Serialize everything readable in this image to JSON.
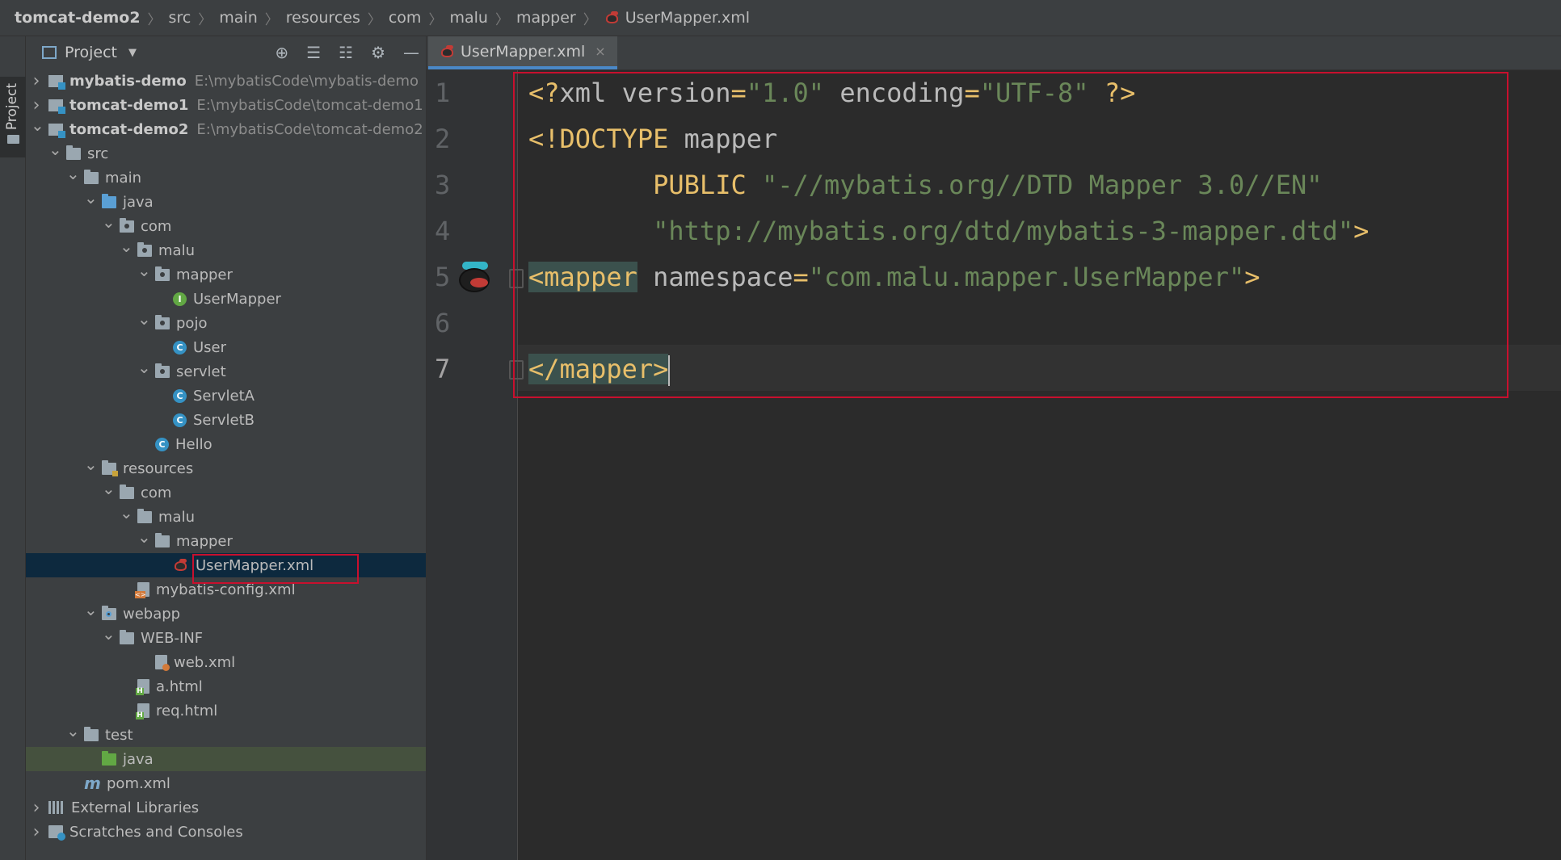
{
  "breadcrumb": [
    "tomcat-demo2",
    "src",
    "main",
    "resources",
    "com",
    "malu",
    "mapper",
    "UserMapper.xml"
  ],
  "stripe": {
    "label": "Project"
  },
  "panel": {
    "title": "Project"
  },
  "tree": [
    {
      "label": "mybatis-demo",
      "path": "E:\\mybatisCode\\mybatis-demo",
      "indent": 0,
      "arrow": "right",
      "icon": "module"
    },
    {
      "label": "tomcat-demo1",
      "path": "E:\\mybatisCode\\tomcat-demo1",
      "indent": 0,
      "arrow": "right",
      "icon": "module"
    },
    {
      "label": "tomcat-demo2",
      "path": "E:\\mybatisCode\\tomcat-demo2",
      "indent": 0,
      "arrow": "down",
      "icon": "module"
    },
    {
      "label": "src",
      "indent": 1,
      "arrow": "down",
      "icon": "folder"
    },
    {
      "label": "main",
      "indent": 2,
      "arrow": "down",
      "icon": "folder"
    },
    {
      "label": "java",
      "indent": 3,
      "arrow": "down",
      "icon": "folder-blue"
    },
    {
      "label": "com",
      "indent": 4,
      "arrow": "down",
      "icon": "package"
    },
    {
      "label": "malu",
      "indent": 5,
      "arrow": "down",
      "icon": "package"
    },
    {
      "label": "mapper",
      "indent": 6,
      "arrow": "down",
      "icon": "package"
    },
    {
      "label": "UserMapper",
      "indent": 7,
      "arrow": "none",
      "icon": "interface"
    },
    {
      "label": "pojo",
      "indent": 6,
      "arrow": "down",
      "icon": "package"
    },
    {
      "label": "User",
      "indent": 7,
      "arrow": "none",
      "icon": "class"
    },
    {
      "label": "servlet",
      "indent": 6,
      "arrow": "down",
      "icon": "package"
    },
    {
      "label": "ServletA",
      "indent": 7,
      "arrow": "none",
      "icon": "class"
    },
    {
      "label": "ServletB",
      "indent": 7,
      "arrow": "none",
      "icon": "class"
    },
    {
      "label": "Hello",
      "indent": 6,
      "arrow": "none",
      "icon": "class"
    },
    {
      "label": "resources",
      "indent": 3,
      "arrow": "down",
      "icon": "folder-res"
    },
    {
      "label": "com",
      "indent": 4,
      "arrow": "down",
      "icon": "folder"
    },
    {
      "label": "malu",
      "indent": 5,
      "arrow": "down",
      "icon": "folder"
    },
    {
      "label": "mapper",
      "indent": 6,
      "arrow": "down",
      "icon": "folder"
    },
    {
      "label": "UserMapper.xml",
      "indent": 7,
      "arrow": "none",
      "icon": "mybatis",
      "selected": true
    },
    {
      "label": "mybatis-config.xml",
      "indent": 5,
      "arrow": "none",
      "icon": "xml-config"
    },
    {
      "label": "webapp",
      "indent": 3,
      "arrow": "down",
      "icon": "folder-web"
    },
    {
      "label": "WEB-INF",
      "indent": 4,
      "arrow": "down",
      "icon": "folder"
    },
    {
      "label": "web.xml",
      "indent": 6,
      "arrow": "none",
      "icon": "web-xml"
    },
    {
      "label": "a.html",
      "indent": 5,
      "arrow": "none",
      "icon": "html"
    },
    {
      "label": "req.html",
      "indent": 5,
      "arrow": "none",
      "icon": "html"
    },
    {
      "label": "test",
      "indent": 2,
      "arrow": "down",
      "icon": "folder"
    },
    {
      "label": "java",
      "indent": 3,
      "arrow": "none",
      "icon": "folder-green",
      "highlighted": true
    },
    {
      "label": "pom.xml",
      "indent": 2,
      "arrow": "none",
      "icon": "maven"
    },
    {
      "label": "External Libraries",
      "indent": 0,
      "arrow": "right",
      "icon": "libraries"
    },
    {
      "label": "Scratches and Consoles",
      "indent": 0,
      "arrow": "right",
      "icon": "scratches"
    }
  ],
  "editor": {
    "tab": "UserMapper.xml",
    "tab_close": "×",
    "line_numbers": [
      "1",
      "2",
      "3",
      "4",
      "5",
      "6",
      "7"
    ],
    "code": {
      "l1": {
        "open": "<?",
        "name": "xml",
        "a1": "version",
        "eq1": "=",
        "v1": "\"1.0\"",
        "a2": "encoding",
        "eq2": "=",
        "v2": "\"UTF-8\"",
        "close": "?>"
      },
      "l2": {
        "open": "<!",
        "name": "DOCTYPE",
        "rest": "mapper"
      },
      "l3": {
        "kw": "PUBLIC",
        "str": "\"-//mybatis.org//DTD Mapper 3.0//EN\""
      },
      "l4": {
        "str": "\"http://mybatis.org/dtd/mybatis-3-mapper.dtd\"",
        "close": ">"
      },
      "l5": {
        "tag": "<mapper",
        "attr": "namespace",
        "eq": "=",
        "str": "\"com.malu.mapper.UserMapper\"",
        "close": ">"
      },
      "l7": {
        "tag": "</mapper",
        "close": ">"
      }
    }
  },
  "colors": {
    "selection": "#0d293e",
    "highlight_box": "#c8102e",
    "tab_underline": "#4a88c7"
  }
}
